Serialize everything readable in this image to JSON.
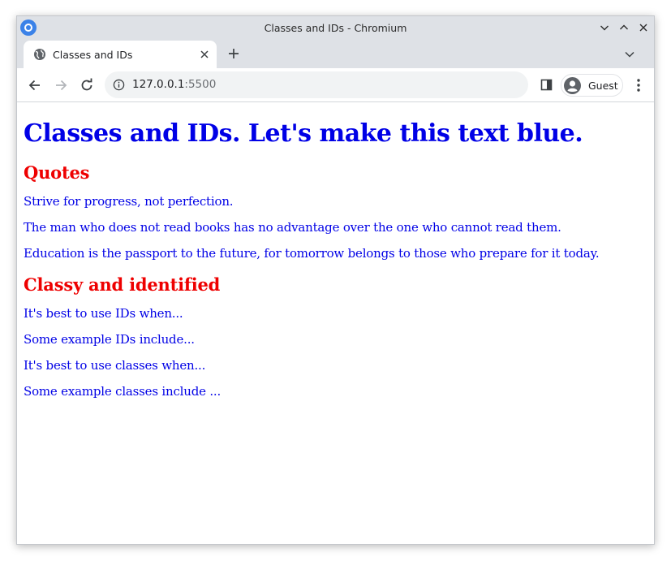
{
  "window": {
    "title": "Classes and IDs - Chromium"
  },
  "tab": {
    "title": "Classes and IDs"
  },
  "toolbar": {
    "url_host": "127.0.0.1",
    "url_port": ":5500",
    "profile_label": "Guest"
  },
  "page": {
    "heading": "Classes and IDs. Let's make this text blue.",
    "quotes_heading": "Quotes",
    "quotes": [
      "Strive for progress, not perfection.",
      "The man who does not read books has no advantage over the one who cannot read them.",
      "Education is the passport to the future, for tomorrow belongs to those who prepare for it today."
    ],
    "classy_heading": "Classy and identified",
    "classy_items": [
      "It's best to use IDs when...",
      "Some example IDs include...",
      "It's best to use classes when...",
      "Some example classes include ..."
    ]
  },
  "colors": {
    "blue_text": "#0000e6",
    "red_heading": "#ee0000",
    "chrome_frame": "#dee1e6"
  },
  "icons": {
    "app": "chromium-icon",
    "minimize": "chevron-down-icon",
    "maximize": "chevron-up-icon",
    "close": "close-icon",
    "favicon": "globe-icon",
    "tab_close": "close-icon",
    "new_tab": "plus-icon",
    "tab_search": "chevron-down-icon",
    "back": "arrow-left-icon",
    "forward": "arrow-right-icon",
    "reload": "reload-icon",
    "site_info": "info-icon",
    "side_panel": "side-panel-icon",
    "profile": "avatar-icon",
    "menu": "kebab-menu-icon"
  }
}
